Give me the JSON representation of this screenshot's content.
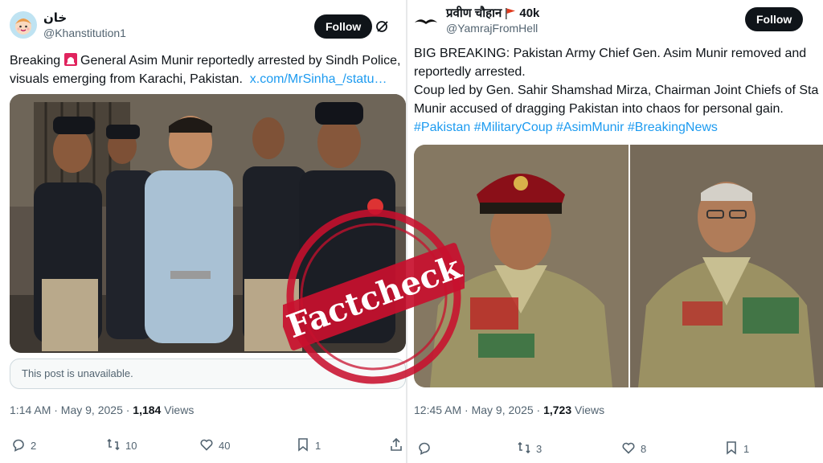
{
  "left_tweet": {
    "display_name": "خان",
    "handle": "@Khanstitution1",
    "follow_label": "Follow",
    "text_line1_before": "Breaking ",
    "text_line1_after": " General Asim Munir reportedly arrested by Sindh Police,",
    "text_line2": "visuals emerging from Karachi, Pakistan.",
    "link": "x.com/MrSinha_/statu…",
    "unavailable_text": "This post is unavailable.",
    "time": "1:14 AM · May 9, 2025 · ",
    "views_count": "1,184",
    "views_label": " Views",
    "replies": "2",
    "reposts": "10",
    "likes": "40",
    "bookmarks": "1"
  },
  "right_tweet": {
    "display_name": "प्रवीण चौहान",
    "flag_count": "40k",
    "handle": "@YamrajFromHell",
    "follow_label": "Follow",
    "line1": "BIG BREAKING: Pakistan Army Chief Gen. Asim Munir removed and",
    "line2": "reportedly arrested.",
    "line3": "Coup led by Gen. Sahir Shamshad Mirza, Chairman Joint Chiefs of Sta",
    "line4": "Munir accused of dragging Pakistan into chaos for personal gain.",
    "hashtags": "#Pakistan #MilitaryCoup #AsimMunir #BreakingNews",
    "time": "12:45 AM · May 9, 2025 · ",
    "views_count": "1,723",
    "views_label": " Views",
    "reposts": "3",
    "likes": "8",
    "bookmarks": "1"
  },
  "stamp": {
    "text": "Factcheck",
    "color": "#c8102e"
  },
  "colors": {
    "link": "#1d9bf0",
    "muted": "#536471",
    "text": "#0f1419"
  },
  "icons": [
    "reply-icon",
    "repost-icon",
    "like-icon",
    "bookmark-icon",
    "share-icon",
    "grok-icon",
    "siren-icon",
    "flag-icon"
  ]
}
